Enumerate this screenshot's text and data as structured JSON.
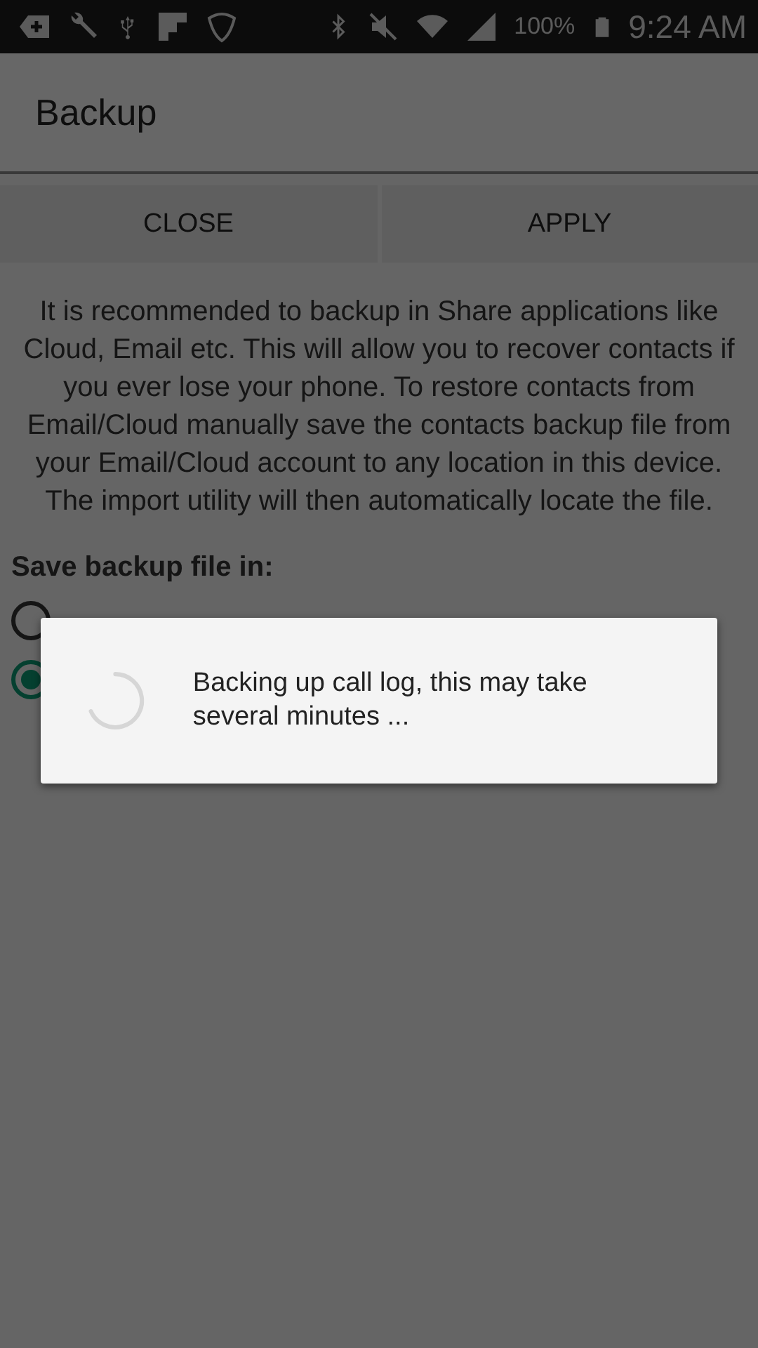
{
  "status_bar": {
    "battery": "100%",
    "time": "9:24 AM"
  },
  "header": {
    "title": "Backup"
  },
  "buttons": [
    "CLOSE",
    "APPLY"
  ],
  "description": "It is recommended to backup in Share applications like Cloud, Email etc. This will allow you to recover contacts if you ever lose your phone. To restore contacts from Email/Cloud manually save the contacts backup file from your Email/Cloud account to any location in this device. The import utility will then automatically locate the file.",
  "save_section": {
    "label": "Save backup file in:",
    "options": [
      {
        "selected": false
      },
      {
        "selected": true
      }
    ]
  },
  "progress_dialog": {
    "message": "Backing up call log, this may take several minutes ..."
  }
}
